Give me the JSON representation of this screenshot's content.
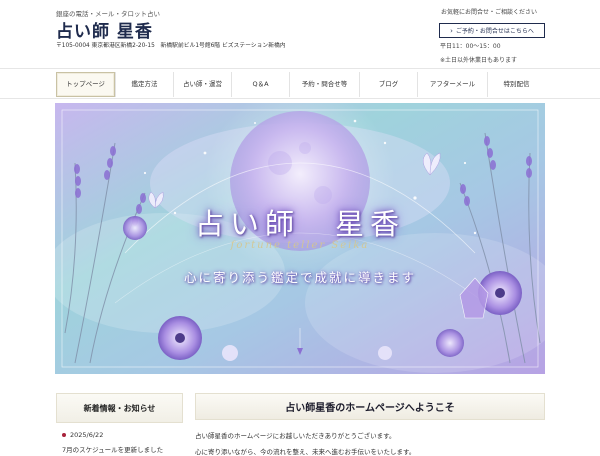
{
  "header": {
    "tagline": "銀座の電話・メール・タロット占い",
    "site_title": "占い師 星香",
    "address": "〒105-0004 東京都港区新橋2-20-15　新橋駅前ビル1号館6階 ビズステーション新橋内",
    "contact_note": "お気軽にお問合せ・ご相談ください",
    "contact_button": "ご予約・お問合せはこちらへ",
    "hours": "平日11：00～15：00",
    "holiday_note": "※土日以外休業日もあります"
  },
  "nav": {
    "items": [
      {
        "label": "トップページ"
      },
      {
        "label": "鑑定方法"
      },
      {
        "label": "占い師・運営"
      },
      {
        "label": "Q＆A"
      },
      {
        "label": "予約・問合せ等"
      },
      {
        "label": "ブログ"
      },
      {
        "label": "アフターメール"
      },
      {
        "label": "特別配信"
      }
    ]
  },
  "hero": {
    "title": "占い師　星香",
    "subtitle": "fortune teller Seika",
    "catchphrase": "心に寄り添う鑑定で成就に導きます"
  },
  "news": {
    "heading": "新着情報・お知らせ",
    "items": [
      {
        "date": "2025/6/22",
        "text": "7月のスケジュールを更新しました"
      }
    ]
  },
  "main": {
    "welcome_heading": "占い師星香のホームページへようこそ",
    "paragraph1": "占い師星香のホームページにお越しいただきありがとうございます。",
    "paragraph2": "心に寄り添いながら、今の流れを整え、未来へ進むお手伝いをいたします。"
  },
  "colors": {
    "navy": "#1f2b4d",
    "accent_red": "#a8233c",
    "hero_purple": "#9a86d8",
    "hero_mint": "#b6e4dc"
  },
  "icons": {
    "contact_button_icon": "chevron-right-icon",
    "news_bullet": "dot-icon"
  }
}
